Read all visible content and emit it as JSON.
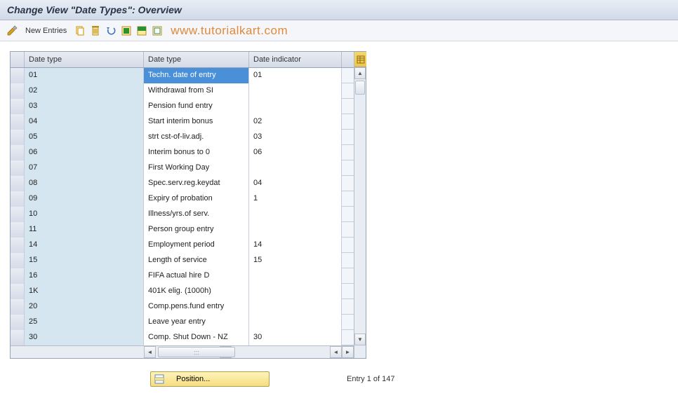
{
  "title": "Change View \"Date Types\": Overview",
  "toolbar": {
    "new_entries_label": "New Entries"
  },
  "watermark": "www.tutorialkart.com",
  "table": {
    "columns": [
      "Date type",
      "Date type",
      "Date indicator"
    ],
    "rows": [
      {
        "c1": "01",
        "c2": "Techn. date of entry",
        "c3": "01",
        "selected": true
      },
      {
        "c1": "02",
        "c2": "Withdrawal from SI",
        "c3": ""
      },
      {
        "c1": "03",
        "c2": "Pension fund entry",
        "c3": ""
      },
      {
        "c1": "04",
        "c2": "Start interim bonus",
        "c3": "02"
      },
      {
        "c1": "05",
        "c2": "strt cst-of-liv.adj.",
        "c3": "03"
      },
      {
        "c1": "06",
        "c2": "Interim bonus to 0",
        "c3": "06"
      },
      {
        "c1": "07",
        "c2": "First Working Day",
        "c3": ""
      },
      {
        "c1": "08",
        "c2": "Spec.serv.reg.keydat",
        "c3": "04"
      },
      {
        "c1": "09",
        "c2": "Expiry of probation",
        "c3": "1"
      },
      {
        "c1": "10",
        "c2": "Illness/yrs.of serv.",
        "c3": ""
      },
      {
        "c1": "11",
        "c2": "Person group entry",
        "c3": ""
      },
      {
        "c1": "14",
        "c2": "Employment period",
        "c3": "14"
      },
      {
        "c1": "15",
        "c2": "Length of service",
        "c3": "15"
      },
      {
        "c1": "16",
        "c2": "FIFA actual hire D",
        "c3": ""
      },
      {
        "c1": "1K",
        "c2": "401K elig. (1000h)",
        "c3": ""
      },
      {
        "c1": "20",
        "c2": "Comp.pens.fund entry",
        "c3": ""
      },
      {
        "c1": "25",
        "c2": "Leave year entry",
        "c3": ""
      },
      {
        "c1": "30",
        "c2": "Comp. Shut Down - NZ",
        "c3": "30"
      }
    ]
  },
  "footer": {
    "position_label": "Position...",
    "entry_text": "Entry 1 of 147"
  }
}
